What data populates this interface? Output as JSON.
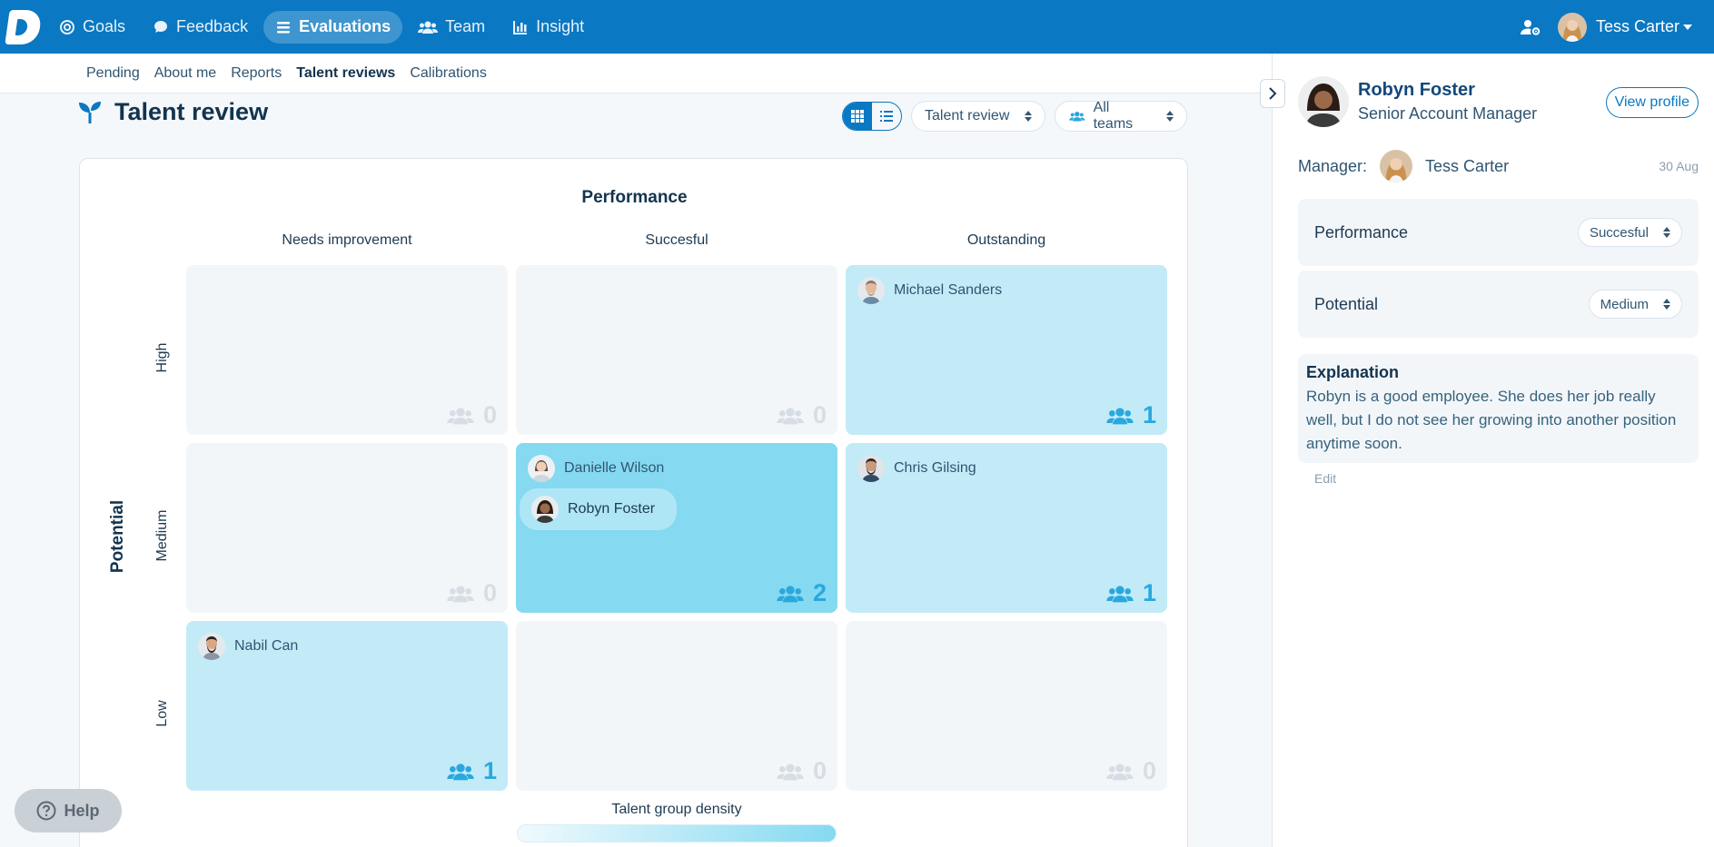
{
  "app": {
    "logo_letter": "D"
  },
  "nav": {
    "items": [
      {
        "label": "Goals",
        "icon": "target-icon"
      },
      {
        "label": "Feedback",
        "icon": "speech-bubble-icon"
      },
      {
        "label": "Evaluations",
        "icon": "list-icon",
        "active": true
      },
      {
        "label": "Team",
        "icon": "people-icon"
      },
      {
        "label": "Insight",
        "icon": "bar-chart-icon"
      }
    ],
    "user_name": "Tess Carter"
  },
  "subnav": {
    "items": [
      {
        "label": "Pending"
      },
      {
        "label": "About me"
      },
      {
        "label": "Reports"
      },
      {
        "label": "Talent reviews",
        "active": true
      },
      {
        "label": "Calibrations"
      }
    ]
  },
  "page": {
    "title": "Talent review",
    "review_select": "Talent review",
    "teams_select": "All teams"
  },
  "grid": {
    "x_axis_title": "Performance",
    "y_axis_title": "Potential",
    "columns": [
      "Needs improvement",
      "Succesful",
      "Outstanding"
    ],
    "rows": [
      "High",
      "Medium",
      "Low"
    ],
    "cells": {
      "high_needs": {
        "count": "0",
        "people": []
      },
      "high_succ": {
        "count": "0",
        "people": []
      },
      "high_out": {
        "count": "1",
        "people": [
          "Michael Sanders"
        ]
      },
      "med_needs": {
        "count": "0",
        "people": []
      },
      "med_succ": {
        "count": "2",
        "people": [
          "Danielle Wilson",
          "Robyn Foster"
        ]
      },
      "med_out": {
        "count": "1",
        "people": [
          "Chris Gilsing"
        ]
      },
      "low_needs": {
        "count": "1",
        "people": [
          "Nabil Can"
        ]
      },
      "low_succ": {
        "count": "0",
        "people": []
      },
      "low_out": {
        "count": "0",
        "people": []
      }
    },
    "density_label": "Talent group density"
  },
  "help": {
    "label": "Help"
  },
  "panel": {
    "employee_name": "Robyn Foster",
    "employee_role": "Senior Account Manager",
    "view_profile": "View profile",
    "manager_label": "Manager:",
    "manager_name": "Tess Carter",
    "date": "30 Aug",
    "performance_label": "Performance",
    "performance_value": "Succesful",
    "potential_label": "Potential",
    "potential_value": "Medium",
    "explanation_title": "Explanation",
    "explanation_text": "Robyn is a good employee. She does her job really well, but I do not see her growing into another position anytime soon.",
    "edit_label": "Edit"
  },
  "colors": {
    "brand": "#0a78c2",
    "cell_empty": "#f3f6f9",
    "cell_light": "#c2ebf7",
    "cell_mid": "#85d9f1",
    "count_accent": "#2aa8dd"
  }
}
